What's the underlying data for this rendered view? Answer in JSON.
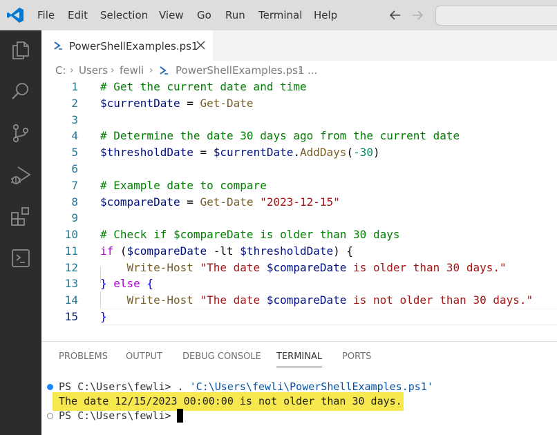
{
  "menu": {
    "items": [
      "File",
      "Edit",
      "Selection",
      "View",
      "Go",
      "Run",
      "Terminal",
      "Help"
    ]
  },
  "tab": {
    "label": "PowerShellExamples.ps1",
    "icon": "powershell-icon"
  },
  "breadcrumb": {
    "items": [
      "C:",
      "Users",
      "fewli",
      "PowerShellExamples.ps1",
      "..."
    ]
  },
  "editor": {
    "line_numbers": [
      "1",
      "2",
      "3",
      "4",
      "5",
      "6",
      "7",
      "8",
      "9",
      "10",
      "11",
      "12",
      "13",
      "14",
      "15"
    ],
    "active_line": "15",
    "lines": {
      "l1": "# Get the current date and time",
      "l2_var": "$currentDate",
      "l2_op": " = ",
      "l2_cmd": "Get-Date",
      "l4": "# Determine the date 30 days ago from the current date",
      "l5_var": "$thresholdDate",
      "l5_op": " = ",
      "l5_var2": "$currentDate",
      "l5_dot": ".",
      "l5_method": "AddDays",
      "l5_paren_open": "(",
      "l5_num": "-30",
      "l5_paren_close": ")",
      "l7": "# Example date to compare",
      "l8_var": "$compareDate",
      "l8_op": " = ",
      "l8_cmd": "Get-Date",
      "l8_str": " \"2023-12-15\"",
      "l10": "# Check if $compareDate is older than 30 days",
      "l11_kw": "if",
      "l11_a": " (",
      "l11_var": "$compareDate",
      "l11_op": " -lt ",
      "l11_var2": "$thresholdDate",
      "l11_b": ") {",
      "l12_cmd": "Write-Host",
      "l12_str1": " \"The date ",
      "l12_var": "$compareDate",
      "l12_str2": " is older than 30 days.\"",
      "l13_a": "} ",
      "l13_kw": "else",
      "l13_b": " {",
      "l14_cmd": "Write-Host",
      "l14_str1": " \"The date ",
      "l14_var": "$compareDate",
      "l14_str2": " is not older than 30 days.\"",
      "l15": "}"
    }
  },
  "panel": {
    "tabs": [
      "PROBLEMS",
      "OUTPUT",
      "DEBUG CONSOLE",
      "TERMINAL",
      "PORTS"
    ],
    "active_tab": "TERMINAL",
    "terminal": {
      "line1_prompt": "PS C:\\Users\\fewli> ",
      "line1_cmd": ". ",
      "line1_path": "'C:\\Users\\fewli\\PowerShellExamples.ps1'",
      "line2_output": "The date 12/15/2023 00:00:00 is not older than 30 days.",
      "line3_prompt": "PS C:\\Users\\fewli> "
    }
  },
  "colors": {
    "activity_bar": "#2c2c2c",
    "title_bar": "#dddddd",
    "highlight": "#f7e84f",
    "vscode_blue": "#0078d4"
  },
  "activity_icons": [
    "explorer-icon",
    "search-icon",
    "source-control-icon",
    "run-debug-icon",
    "extensions-icon",
    "terminal-icon"
  ]
}
